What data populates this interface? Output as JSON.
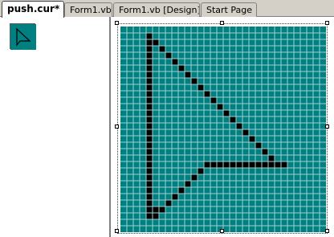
{
  "tabs": [
    {
      "label": "push.cur*",
      "active": true
    },
    {
      "label": "Form1.vb",
      "active": false
    },
    {
      "label": "Form1.vb [Design]",
      "active": false
    },
    {
      "label": "Start Page",
      "active": false
    }
  ],
  "colors": {
    "background_pixel": "#008080",
    "foreground_pixel": "#000000",
    "grid_line": "#9fd0d0"
  },
  "thumbnail": {
    "icon": "cursor-arrow-icon"
  },
  "editor": {
    "icon": "cursor-arrow-icon"
  }
}
